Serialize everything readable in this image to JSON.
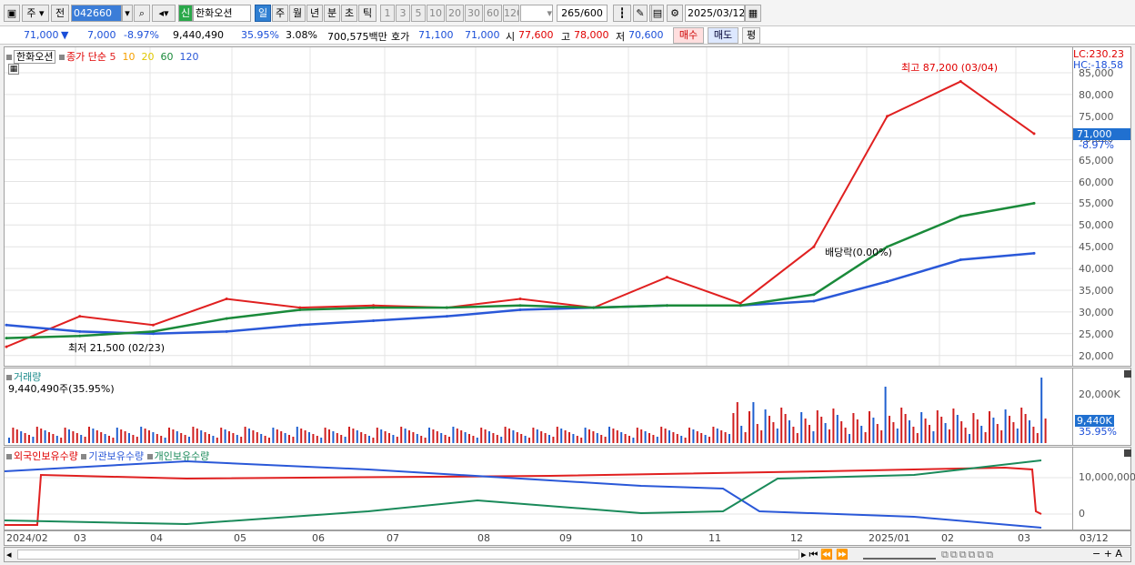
{
  "toolbar": {
    "market": "주",
    "prev": "전",
    "code": "042660",
    "name": "한화오션",
    "new_badge": "신",
    "periods": [
      "일",
      "주",
      "월",
      "년",
      "분",
      "초",
      "틱"
    ],
    "intervals": [
      "1",
      "3",
      "5",
      "10",
      "20",
      "30",
      "60",
      "120"
    ],
    "count": "265",
    "total": "/600",
    "date": "2025/03/12"
  },
  "info": {
    "price": "71,000",
    "down_arrow": "▼",
    "change": "7,000",
    "change_pct": "-8.97%",
    "volume": "9,440,490",
    "vol_ratio": "35.95%",
    "turnover": "3.08%",
    "amount": "700,575백만",
    "ask_label": "호가",
    "ask": "71,100",
    "bid": "71,000",
    "open_label": "시",
    "open": "77,600",
    "high_label": "고",
    "high": "78,000",
    "low_label": "저",
    "low": "70,600",
    "buy": "매수",
    "sell": "매도",
    "avg": "평"
  },
  "price_pane": {
    "name": "한화오션",
    "ma_label": "종가 단순",
    "ma": [
      {
        "label": "5",
        "color": "#e02020"
      },
      {
        "label": "10",
        "color": "#f5a000"
      },
      {
        "label": "20",
        "color": "#f0e000"
      },
      {
        "label": "60",
        "color": "#1a8a3a"
      },
      {
        "label": "120",
        "color": "#2a58d8"
      }
    ],
    "high_note": "최고 87,200 (03/04)",
    "low_note": "최저 21,500 (02/23)",
    "dividend_note": "배당락(0.00%)",
    "lc": "LC:230.23",
    "hc": "HC:-18.58",
    "cur_price": "71,000",
    "cur_pct": "-8.97%",
    "ticks": [
      "85,000",
      "80,000",
      "75,000",
      "70,000",
      "65,000",
      "60,000",
      "55,000",
      "50,000",
      "45,000",
      "40,000",
      "35,000",
      "30,000",
      "25,000",
      "20,000"
    ]
  },
  "volume_pane": {
    "title": "거래량",
    "value": "9,440,490주(35.95%)",
    "tick": "20,000K",
    "cur": "9,440K",
    "cur_pct": "35.95%"
  },
  "holding_pane": {
    "legend": [
      "외국인보유수량",
      "기관보유수량",
      "개인보유수량"
    ],
    "ticks": [
      "10,000,000",
      "0"
    ]
  },
  "x_labels": [
    "2024/02",
    "03",
    "04",
    "05",
    "06",
    "07",
    "08",
    "09",
    "10",
    "11",
    "12",
    "2025/01",
    "02",
    "03",
    "03/12"
  ],
  "chart_data": {
    "type": "line",
    "x": [
      "2024/02",
      "2024/03",
      "2024/04",
      "2024/05",
      "2024/06",
      "2024/07",
      "2024/08",
      "2024/09",
      "2024/10",
      "2024/11",
      "2024/12",
      "2025/01",
      "2025/02",
      "2025/03",
      "2025/03/12"
    ],
    "series": [
      {
        "name": "종가",
        "values": [
          22000,
          29000,
          27000,
          33000,
          31000,
          31500,
          31000,
          33000,
          31000,
          38000,
          32000,
          45000,
          75000,
          83000,
          71000
        ]
      },
      {
        "name": "120",
        "values": [
          27000,
          25500,
          25000,
          25500,
          27000,
          28000,
          29000,
          30500,
          31000,
          31500,
          31500,
          32500,
          37000,
          42000,
          43500
        ]
      },
      {
        "name": "60",
        "values": [
          24000,
          24500,
          25500,
          28500,
          30500,
          31000,
          31000,
          31500,
          31000,
          31500,
          31500,
          34000,
          45000,
          52000,
          55000
        ]
      }
    ],
    "ylim": [
      19000,
      87000
    ]
  }
}
